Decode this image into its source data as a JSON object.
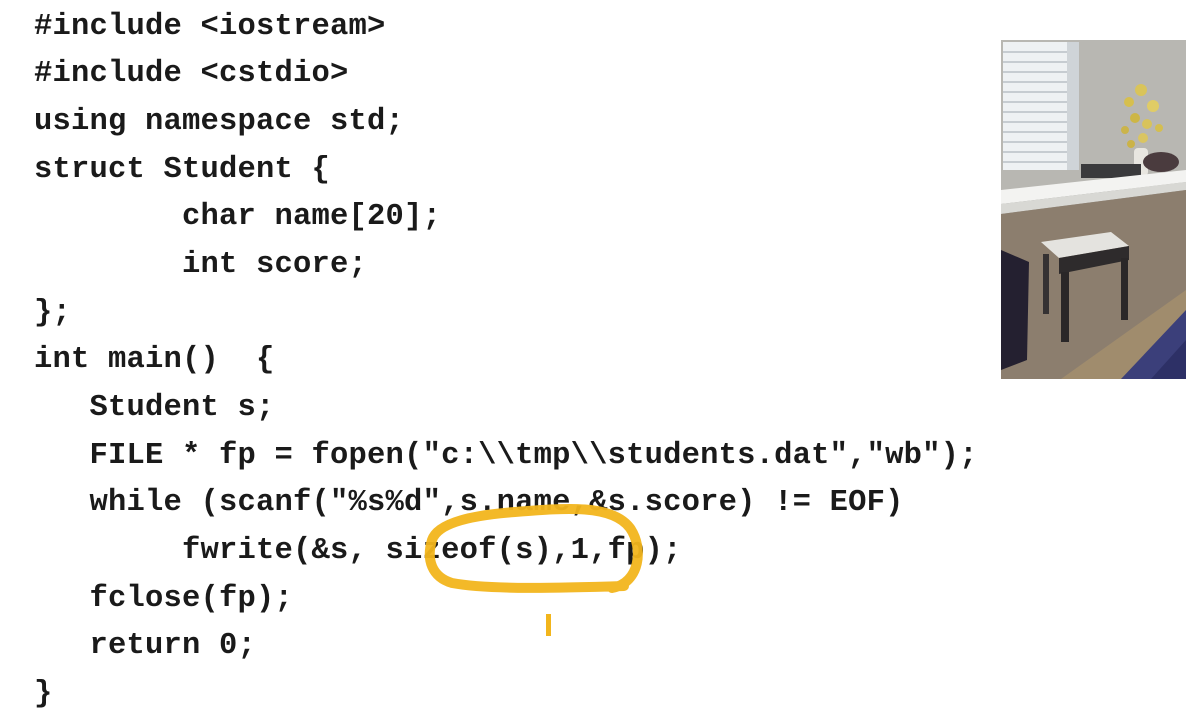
{
  "code": {
    "lines": [
      "#include <iostream>",
      "#include <cstdio>",
      "using namespace std;",
      "struct Student {",
      "        char name[20];",
      "        int score;",
      "};",
      "int main()  {",
      "   Student s;",
      "   FILE * fp = fopen(\"c:\\\\tmp\\\\students.dat\",\"wb\");",
      "   while (scanf(\"%s%d\",s.name,&s.score) != EOF)",
      "        fwrite(&s, sizeof(s),1,fp);",
      "   fclose(fp);",
      "   return 0;",
      "}"
    ]
  },
  "annotation": {
    "highlight_color": "#f2b51c",
    "target_text": "sizeof(s)"
  },
  "webcam": {
    "label": "presenter-webcam-feed"
  }
}
